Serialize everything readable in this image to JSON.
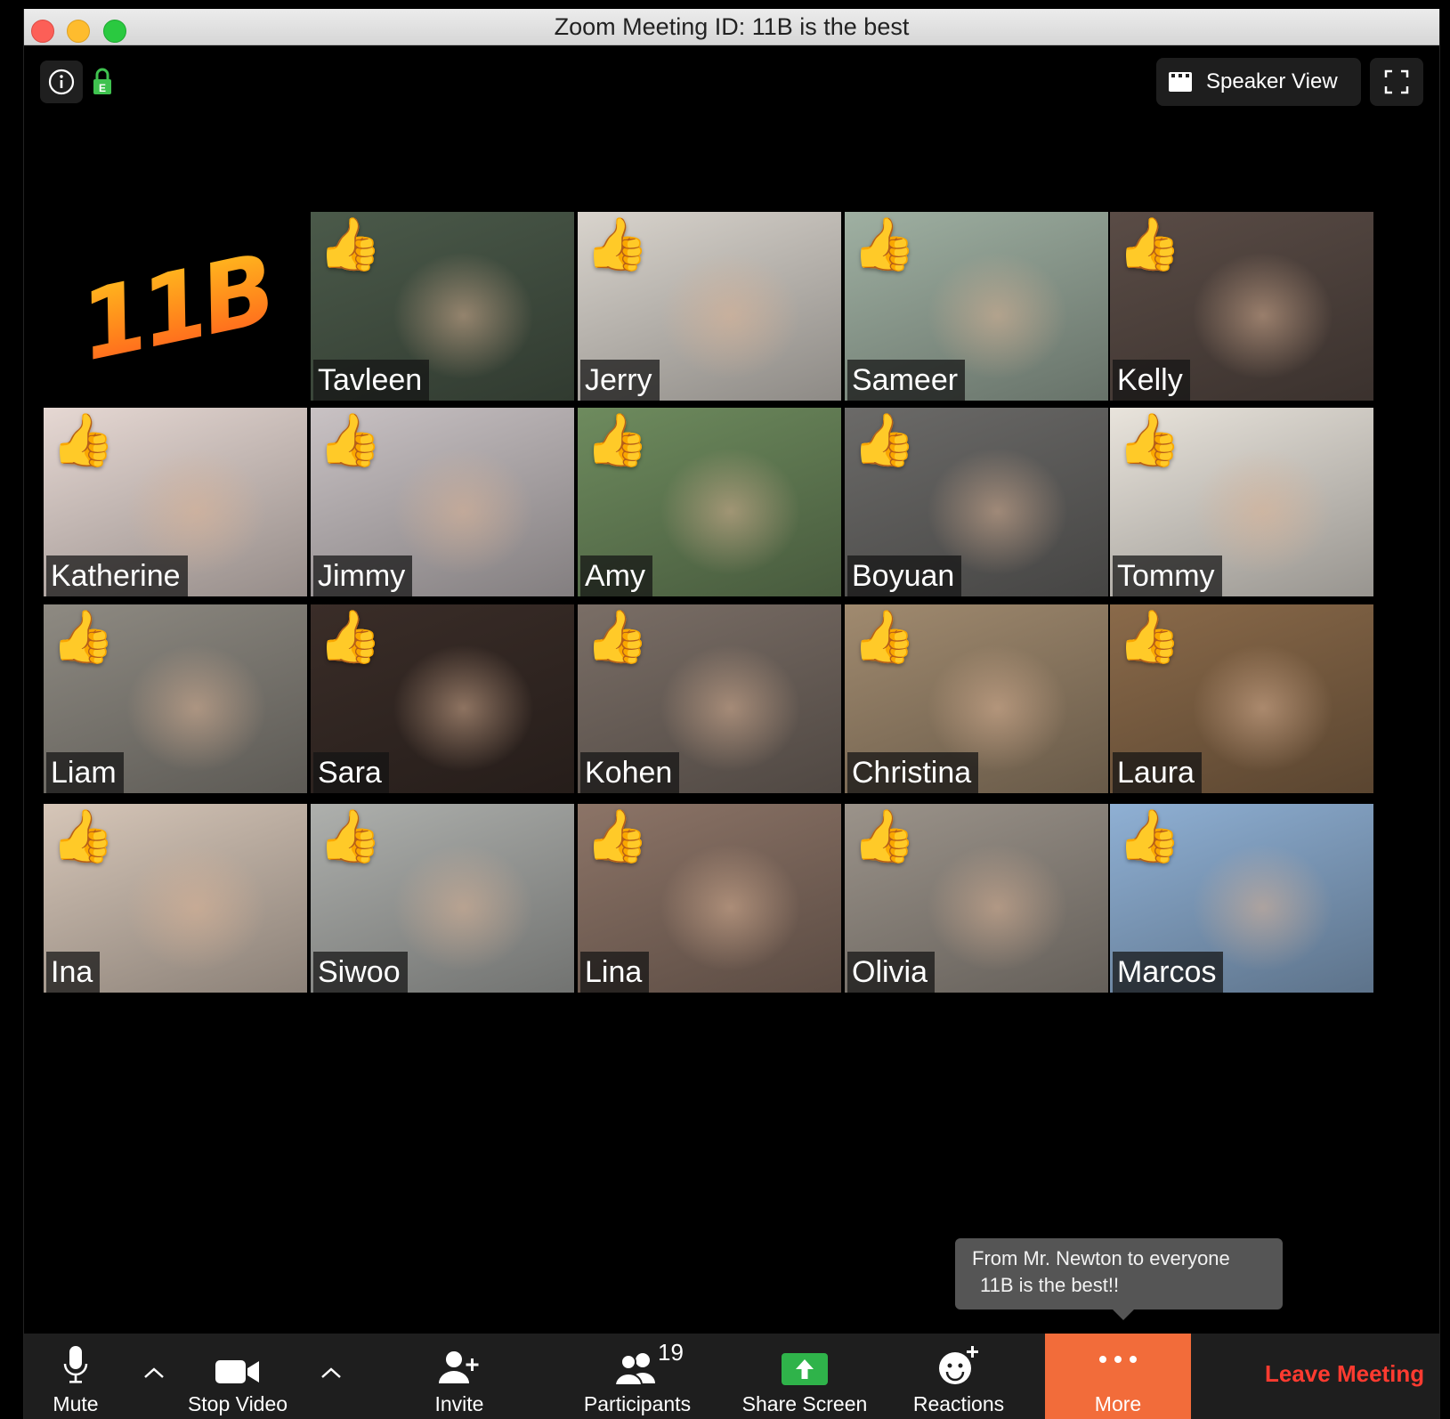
{
  "window": {
    "title": "Zoom Meeting ID: 11B is the best"
  },
  "top_bar": {
    "speaker_view_label": "Speaker View"
  },
  "logo": {
    "text": "11B"
  },
  "participants": [
    {
      "name": "Tavleen",
      "bg": "#4b5a4a"
    },
    {
      "name": "Jerry",
      "bg": "#d9d4cd"
    },
    {
      "name": "Sameer",
      "bg": "#9fb0a2"
    },
    {
      "name": "Kelly",
      "bg": "#5a4c46"
    },
    {
      "name": "Katherine",
      "bg": "#e6d8d3"
    },
    {
      "name": "Jimmy",
      "bg": "#c9c2c4"
    },
    {
      "name": "Amy",
      "bg": "#6e8b5e"
    },
    {
      "name": "Boyuan",
      "bg": "#6b6a68"
    },
    {
      "name": "Tommy",
      "bg": "#e9e4dc"
    },
    {
      "name": "Liam",
      "bg": "#8e8a82"
    },
    {
      "name": "Sara",
      "bg": "#3a2d28"
    },
    {
      "name": "Kohen",
      "bg": "#7a6e66"
    },
    {
      "name": "Christina",
      "bg": "#a08a6f"
    },
    {
      "name": "Laura",
      "bg": "#8a6a4a"
    },
    {
      "name": "Ina",
      "bg": "#d6c6b8"
    },
    {
      "name": "Siwoo",
      "bg": "#aeb0ad"
    },
    {
      "name": "Lina",
      "bg": "#8c7467"
    },
    {
      "name": "Olivia",
      "bg": "#9b938a"
    },
    {
      "name": "Marcos",
      "bg": "#8fb0d4"
    }
  ],
  "chat": {
    "from": "From Mr. Newton to everyone",
    "message": "11B is the best!!"
  },
  "toolbar": {
    "mute": "Mute",
    "stop_video": "Stop Video",
    "invite": "Invite",
    "participants": "Participants",
    "participants_count": "19",
    "share_screen": "Share Screen",
    "reactions": "Reactions",
    "more": "More",
    "leave": "Leave Meeting"
  },
  "colors": {
    "accent_more": "#f26c3a",
    "leave_red": "#ff3b30",
    "share_green": "#2fb34a",
    "lock_green": "#3fc24f"
  },
  "icons": {
    "reaction": "thumbs-up",
    "info": "info-circle",
    "lock": "lock",
    "gallery": "grid",
    "fullscreen": "expand"
  }
}
